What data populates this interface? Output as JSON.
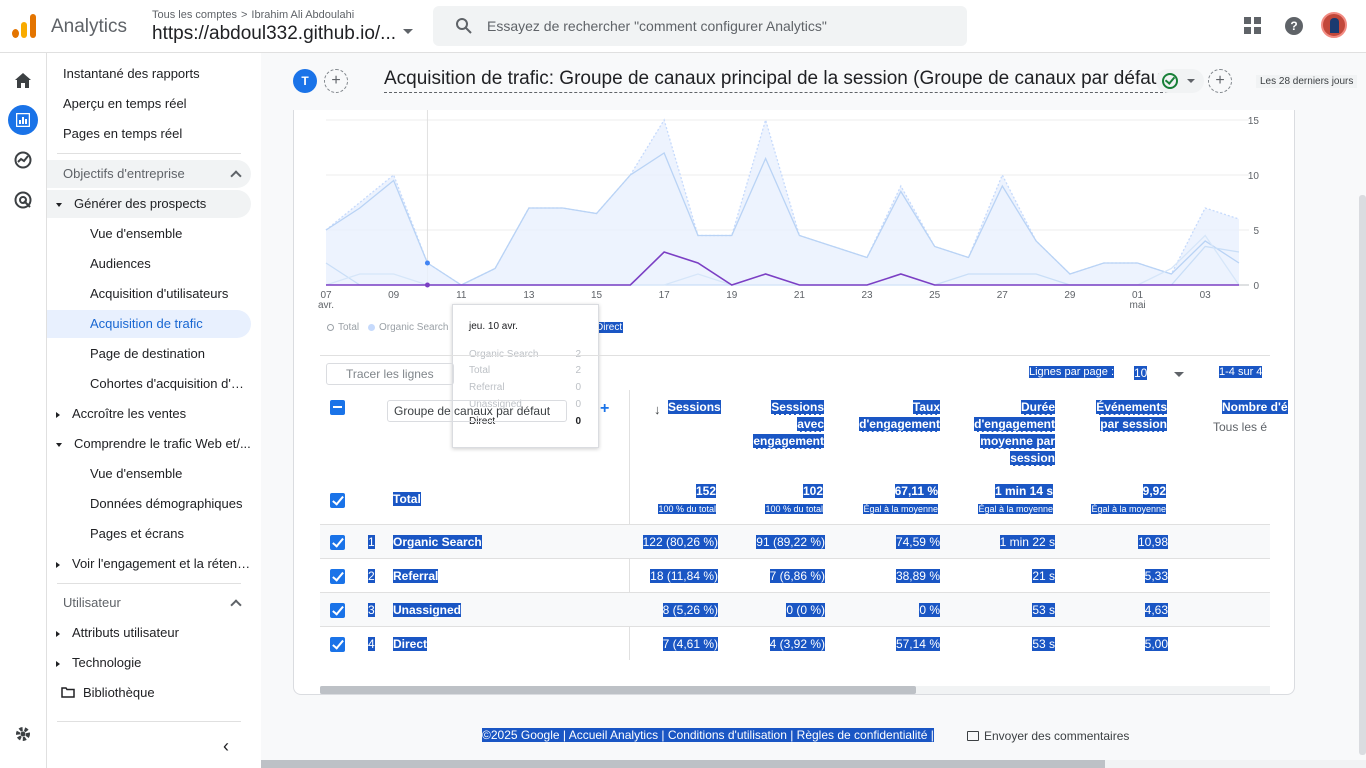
{
  "header": {
    "app_name": "Analytics",
    "crumb_accounts": "Tous les comptes",
    "crumb_user": "Ibrahim Ali Abdoulahi",
    "property": "https://abdoul332.github.io/...",
    "search_placeholder": "Essayez de rechercher \"comment configurer Analytics\"",
    "help_glyph": "?"
  },
  "nav": {
    "items": [
      "Instantané des rapports",
      "Aperçu en temps réel",
      "Pages en temps réel"
    ],
    "section_business": "Objectifs d'entreprise",
    "leads_group": "Générer des prospects",
    "leads_items": [
      "Vue d'ensemble",
      "Audiences",
      "Acquisition d'utilisateurs",
      "Acquisition de trafic",
      "Page de destination",
      "Cohortes d'acquisition d'ut..."
    ],
    "sales_group": "Accroître les ventes",
    "web_group": "Comprendre le trafic Web et/...",
    "web_items": [
      "Vue d'ensemble",
      "Données démographiques",
      "Pages et écrans"
    ],
    "engagement_group": "Voir l'engagement et la rétent...",
    "section_user": "Utilisateur",
    "user_items": [
      "Attributs utilisateur",
      "Technologie"
    ],
    "library": "Bibliothèque"
  },
  "report": {
    "comparison_letter": "T",
    "title": "Acquisition de trafic: Groupe de canaux principal de la session (Groupe de canaux par défaut)",
    "date_range": "Les 28 derniers jours",
    "plus": "+"
  },
  "chart_data": {
    "type": "line",
    "x": [
      "07 avr.",
      "08",
      "09",
      "10",
      "11",
      "12",
      "13",
      "14",
      "15",
      "16",
      "17",
      "18",
      "19",
      "20",
      "21",
      "22",
      "23",
      "24",
      "25",
      "26",
      "27",
      "28",
      "29",
      "30",
      "01 mai",
      "02",
      "03",
      "04"
    ],
    "x_tick_labels": [
      {
        "line1": "07",
        "line2": "avr."
      },
      {
        "line1": "09",
        "line2": ""
      },
      {
        "line1": "11",
        "line2": ""
      },
      {
        "line1": "13",
        "line2": ""
      },
      {
        "line1": "15",
        "line2": ""
      },
      {
        "line1": "17",
        "line2": ""
      },
      {
        "line1": "19",
        "line2": ""
      },
      {
        "line1": "21",
        "line2": ""
      },
      {
        "line1": "23",
        "line2": ""
      },
      {
        "line1": "25",
        "line2": ""
      },
      {
        "line1": "27",
        "line2": ""
      },
      {
        "line1": "29",
        "line2": ""
      },
      {
        "line1": "01",
        "line2": "mai"
      },
      {
        "line1": "03",
        "line2": ""
      }
    ],
    "y_ticks": [
      "15",
      "10",
      "5",
      "0"
    ],
    "ylim": [
      0,
      15
    ],
    "series": [
      {
        "name": "Total",
        "color": "#c6dafc",
        "values": [
          5,
          7.5,
          10,
          2,
          0,
          1.5,
          7,
          7,
          6.5,
          10,
          15,
          4.5,
          4.5,
          15,
          4.5,
          3.5,
          2.5,
          9,
          3.5,
          2.5,
          10,
          4,
          1,
          2,
          2,
          1,
          7,
          6
        ]
      },
      {
        "name": "Organic Search",
        "color": "#b9d3f5",
        "values": [
          5,
          7,
          9.5,
          2,
          0,
          1.5,
          7,
          7,
          6.5,
          10,
          12,
          4.5,
          4.5,
          11.5,
          4.5,
          3.5,
          2.5,
          8.5,
          3.5,
          2.5,
          9,
          4,
          1,
          2,
          2,
          1,
          4,
          2
        ]
      },
      {
        "name": "Referral",
        "color": "#c9def7",
        "values": [
          2,
          0,
          0,
          0,
          0,
          0,
          0,
          0,
          0,
          0,
          0,
          0,
          0,
          0,
          0,
          0,
          0,
          0,
          0,
          1,
          1,
          1,
          0,
          0,
          0,
          0,
          3.5,
          3
        ]
      },
      {
        "name": "Unassigned",
        "color": "#d6e6f9",
        "values": [
          0,
          1,
          1,
          0,
          0,
          0,
          0,
          0,
          0,
          0,
          0,
          1,
          0,
          0,
          0,
          0,
          0,
          0,
          0,
          0,
          0,
          0,
          0,
          0,
          0,
          1.5,
          4.5,
          0
        ]
      },
      {
        "name": "Direct",
        "color": "#7b3fc4",
        "values": [
          0,
          0,
          0,
          0,
          0,
          0,
          0,
          0,
          0,
          0,
          3,
          2,
          0,
          1,
          0,
          0,
          0,
          1,
          0,
          0,
          0,
          0,
          0,
          0,
          0,
          0,
          0,
          0
        ]
      }
    ],
    "legend": [
      "Total",
      "Organic Search",
      "Referral",
      "Unassigned",
      "Direct"
    ]
  },
  "tooltip": {
    "date": "jeu. 10 avr.",
    "rows": [
      {
        "label": "Organic Search",
        "value": "2"
      },
      {
        "label": "Total",
        "value": "2"
      },
      {
        "label": "Referral",
        "value": "0"
      },
      {
        "label": "Unassigned",
        "value": "0"
      },
      {
        "label": "Direct",
        "value": "0"
      }
    ]
  },
  "table": {
    "trace_placeholder": "Tracer les lignes",
    "rows_per_page_label": "Lignes par page :",
    "rows_per_page": "10",
    "paging": "1-4 sur 4",
    "dimension": "Groupe de canaux par défaut",
    "columns": [
      {
        "lines": [
          "Sessions"
        ]
      },
      {
        "lines": [
          "Sessions",
          "avec",
          "engagement"
        ]
      },
      {
        "lines": [
          "Taux",
          "d'engagement"
        ]
      },
      {
        "lines": [
          "Durée",
          "d'engagement",
          "moyenne par",
          "session"
        ]
      },
      {
        "lines": [
          "Événements",
          "par session"
        ]
      },
      {
        "lines": [
          "Nombre d'é"
        ]
      }
    ],
    "last_col_sub": "Tous les é",
    "total_label": "Total",
    "totals": [
      "152",
      "102",
      "67,11 %",
      "1 min 14 s",
      "9,92"
    ],
    "totals_sub": [
      "100 % du total",
      "100 % du total",
      "Égal à la moyenne",
      "Égal à la moyenne",
      "Égal à la moyenne"
    ],
    "rows": [
      {
        "num": "1",
        "dim": "Organic Search",
        "cells": [
          "122 (80,26 %)",
          "91 (89,22 %)",
          "74,59 %",
          "1 min 22 s",
          "10,98"
        ]
      },
      {
        "num": "2",
        "dim": "Referral",
        "cells": [
          "18 (11,84 %)",
          "7 (6,86 %)",
          "38,89 %",
          "21 s",
          "5,33"
        ]
      },
      {
        "num": "3",
        "dim": "Unassigned",
        "cells": [
          "8 (5,26 %)",
          "0 (0 %)",
          "0 %",
          "53 s",
          "4,63"
        ]
      },
      {
        "num": "4",
        "dim": "Direct",
        "cells": [
          "7 (4,61 %)",
          "4 (3,92 %)",
          "57,14 %",
          "53 s",
          "5,00"
        ]
      }
    ]
  },
  "footer": {
    "links": "©2025 Google | Accueil Analytics | Conditions d'utilisation | Règles de confidentialité |",
    "feedback": "Envoyer des commentaires"
  },
  "colors": {
    "accent": "#1a73e8",
    "direct_line": "#7b3fc4",
    "selection": "#1a56c4"
  }
}
